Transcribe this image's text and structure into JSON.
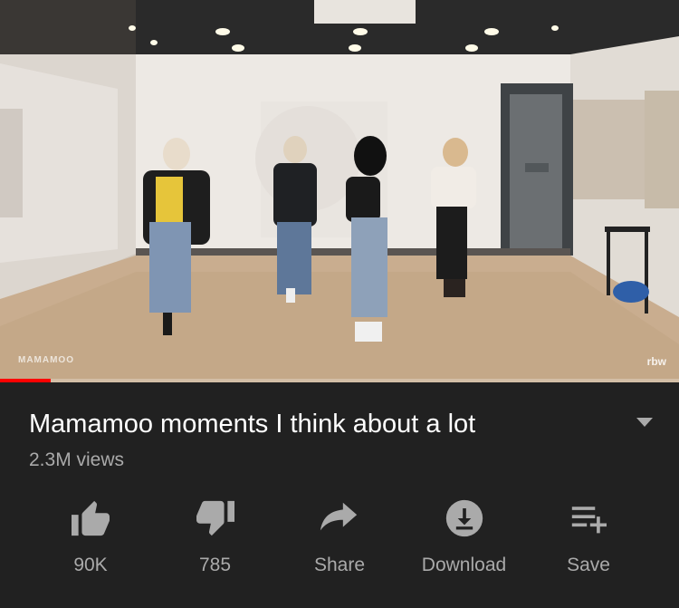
{
  "video": {
    "watermark_left": "MAMAMOO",
    "watermark_right": "rbw",
    "progress_fraction": 0.075,
    "progress_color": "#ff0000"
  },
  "title": "Mamamoo moments I think about a lot",
  "views": "2.3M views",
  "actions": [
    {
      "icon": "thumbs-up-icon",
      "label": "90K"
    },
    {
      "icon": "thumbs-down-icon",
      "label": "785"
    },
    {
      "icon": "share-icon",
      "label": "Share"
    },
    {
      "icon": "download-icon",
      "label": "Download"
    },
    {
      "icon": "playlist-add-icon",
      "label": "Save"
    }
  ],
  "colors": {
    "background": "#212121",
    "secondary_text": "#aaaaaa",
    "icon": "#aaaaaa"
  }
}
